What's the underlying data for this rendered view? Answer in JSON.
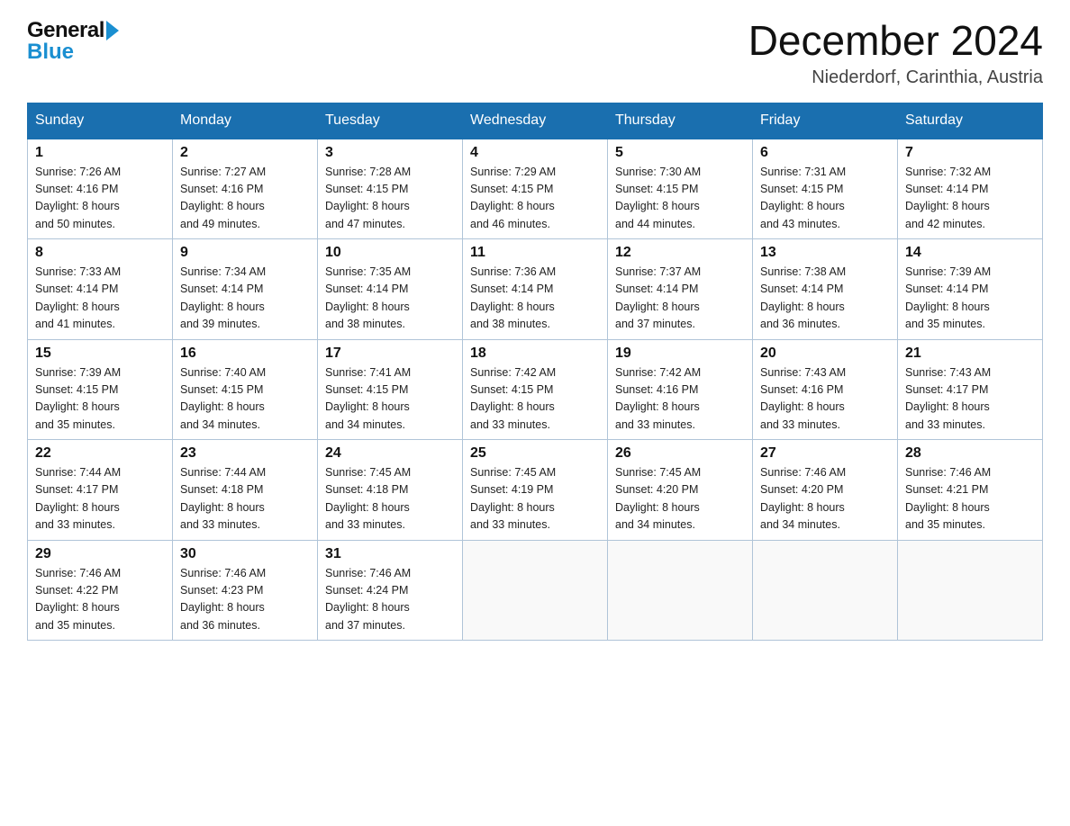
{
  "header": {
    "logo_line1": "General",
    "logo_line2": "Blue",
    "month_title": "December 2024",
    "location": "Niederdorf, Carinthia, Austria"
  },
  "days_of_week": [
    "Sunday",
    "Monday",
    "Tuesday",
    "Wednesday",
    "Thursday",
    "Friday",
    "Saturday"
  ],
  "weeks": [
    [
      {
        "num": "1",
        "sunrise": "7:26 AM",
        "sunset": "4:16 PM",
        "daylight": "8 hours and 50 minutes."
      },
      {
        "num": "2",
        "sunrise": "7:27 AM",
        "sunset": "4:16 PM",
        "daylight": "8 hours and 49 minutes."
      },
      {
        "num": "3",
        "sunrise": "7:28 AM",
        "sunset": "4:15 PM",
        "daylight": "8 hours and 47 minutes."
      },
      {
        "num": "4",
        "sunrise": "7:29 AM",
        "sunset": "4:15 PM",
        "daylight": "8 hours and 46 minutes."
      },
      {
        "num": "5",
        "sunrise": "7:30 AM",
        "sunset": "4:15 PM",
        "daylight": "8 hours and 44 minutes."
      },
      {
        "num": "6",
        "sunrise": "7:31 AM",
        "sunset": "4:15 PM",
        "daylight": "8 hours and 43 minutes."
      },
      {
        "num": "7",
        "sunrise": "7:32 AM",
        "sunset": "4:14 PM",
        "daylight": "8 hours and 42 minutes."
      }
    ],
    [
      {
        "num": "8",
        "sunrise": "7:33 AM",
        "sunset": "4:14 PM",
        "daylight": "8 hours and 41 minutes."
      },
      {
        "num": "9",
        "sunrise": "7:34 AM",
        "sunset": "4:14 PM",
        "daylight": "8 hours and 39 minutes."
      },
      {
        "num": "10",
        "sunrise": "7:35 AM",
        "sunset": "4:14 PM",
        "daylight": "8 hours and 38 minutes."
      },
      {
        "num": "11",
        "sunrise": "7:36 AM",
        "sunset": "4:14 PM",
        "daylight": "8 hours and 38 minutes."
      },
      {
        "num": "12",
        "sunrise": "7:37 AM",
        "sunset": "4:14 PM",
        "daylight": "8 hours and 37 minutes."
      },
      {
        "num": "13",
        "sunrise": "7:38 AM",
        "sunset": "4:14 PM",
        "daylight": "8 hours and 36 minutes."
      },
      {
        "num": "14",
        "sunrise": "7:39 AM",
        "sunset": "4:14 PM",
        "daylight": "8 hours and 35 minutes."
      }
    ],
    [
      {
        "num": "15",
        "sunrise": "7:39 AM",
        "sunset": "4:15 PM",
        "daylight": "8 hours and 35 minutes."
      },
      {
        "num": "16",
        "sunrise": "7:40 AM",
        "sunset": "4:15 PM",
        "daylight": "8 hours and 34 minutes."
      },
      {
        "num": "17",
        "sunrise": "7:41 AM",
        "sunset": "4:15 PM",
        "daylight": "8 hours and 34 minutes."
      },
      {
        "num": "18",
        "sunrise": "7:42 AM",
        "sunset": "4:15 PM",
        "daylight": "8 hours and 33 minutes."
      },
      {
        "num": "19",
        "sunrise": "7:42 AM",
        "sunset": "4:16 PM",
        "daylight": "8 hours and 33 minutes."
      },
      {
        "num": "20",
        "sunrise": "7:43 AM",
        "sunset": "4:16 PM",
        "daylight": "8 hours and 33 minutes."
      },
      {
        "num": "21",
        "sunrise": "7:43 AM",
        "sunset": "4:17 PM",
        "daylight": "8 hours and 33 minutes."
      }
    ],
    [
      {
        "num": "22",
        "sunrise": "7:44 AM",
        "sunset": "4:17 PM",
        "daylight": "8 hours and 33 minutes."
      },
      {
        "num": "23",
        "sunrise": "7:44 AM",
        "sunset": "4:18 PM",
        "daylight": "8 hours and 33 minutes."
      },
      {
        "num": "24",
        "sunrise": "7:45 AM",
        "sunset": "4:18 PM",
        "daylight": "8 hours and 33 minutes."
      },
      {
        "num": "25",
        "sunrise": "7:45 AM",
        "sunset": "4:19 PM",
        "daylight": "8 hours and 33 minutes."
      },
      {
        "num": "26",
        "sunrise": "7:45 AM",
        "sunset": "4:20 PM",
        "daylight": "8 hours and 34 minutes."
      },
      {
        "num": "27",
        "sunrise": "7:46 AM",
        "sunset": "4:20 PM",
        "daylight": "8 hours and 34 minutes."
      },
      {
        "num": "28",
        "sunrise": "7:46 AM",
        "sunset": "4:21 PM",
        "daylight": "8 hours and 35 minutes."
      }
    ],
    [
      {
        "num": "29",
        "sunrise": "7:46 AM",
        "sunset": "4:22 PM",
        "daylight": "8 hours and 35 minutes."
      },
      {
        "num": "30",
        "sunrise": "7:46 AM",
        "sunset": "4:23 PM",
        "daylight": "8 hours and 36 minutes."
      },
      {
        "num": "31",
        "sunrise": "7:46 AM",
        "sunset": "4:24 PM",
        "daylight": "8 hours and 37 minutes."
      },
      null,
      null,
      null,
      null
    ]
  ],
  "labels": {
    "sunrise": "Sunrise:",
    "sunset": "Sunset:",
    "daylight": "Daylight:"
  }
}
